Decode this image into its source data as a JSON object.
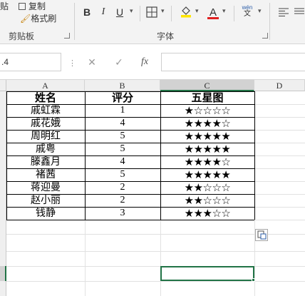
{
  "ribbon": {
    "clipboard": {
      "paste_label": "贴",
      "copy_label": "复制",
      "format_painter_label": "格式刷",
      "group_label": "剪贴板"
    },
    "font": {
      "bold": "B",
      "italic": "I",
      "underline": "U",
      "font_color_letter": "A",
      "phonetic_top": "wén",
      "phonetic_bottom": "文",
      "group_label": "字体",
      "highlight_color": "#ffe600",
      "font_color": "#e02020"
    }
  },
  "formula_bar": {
    "name_box_value": ".4",
    "cancel_icon": "✕",
    "enter_icon": "✓",
    "function_icon": "fx",
    "formula_value": ""
  },
  "columns": [
    "A",
    "B",
    "C",
    "D"
  ],
  "table": {
    "headers": [
      "姓名",
      "评分",
      "五星图"
    ],
    "rows": [
      {
        "name": "戚虹霖",
        "score": "1",
        "stars": "★☆☆☆☆"
      },
      {
        "name": "戚花娥",
        "score": "4",
        "stars": "★★★★☆"
      },
      {
        "name": "周明红",
        "score": "5",
        "stars": "★★★★★"
      },
      {
        "name": "戚粤",
        "score": "5",
        "stars": "★★★★★"
      },
      {
        "name": "滕鑫月",
        "score": "4",
        "stars": "★★★★☆"
      },
      {
        "name": "褚茜",
        "score": "5",
        "stars": "★★★★★"
      },
      {
        "name": "蒋迎曼",
        "score": "2",
        "stars": "★★☆☆☆"
      },
      {
        "name": "赵小丽",
        "score": "2",
        "stars": "★★☆☆☆"
      },
      {
        "name": "钱静",
        "score": "3",
        "stars": "★★★☆☆"
      }
    ]
  },
  "colors": {
    "selection_accent": "#217346"
  }
}
